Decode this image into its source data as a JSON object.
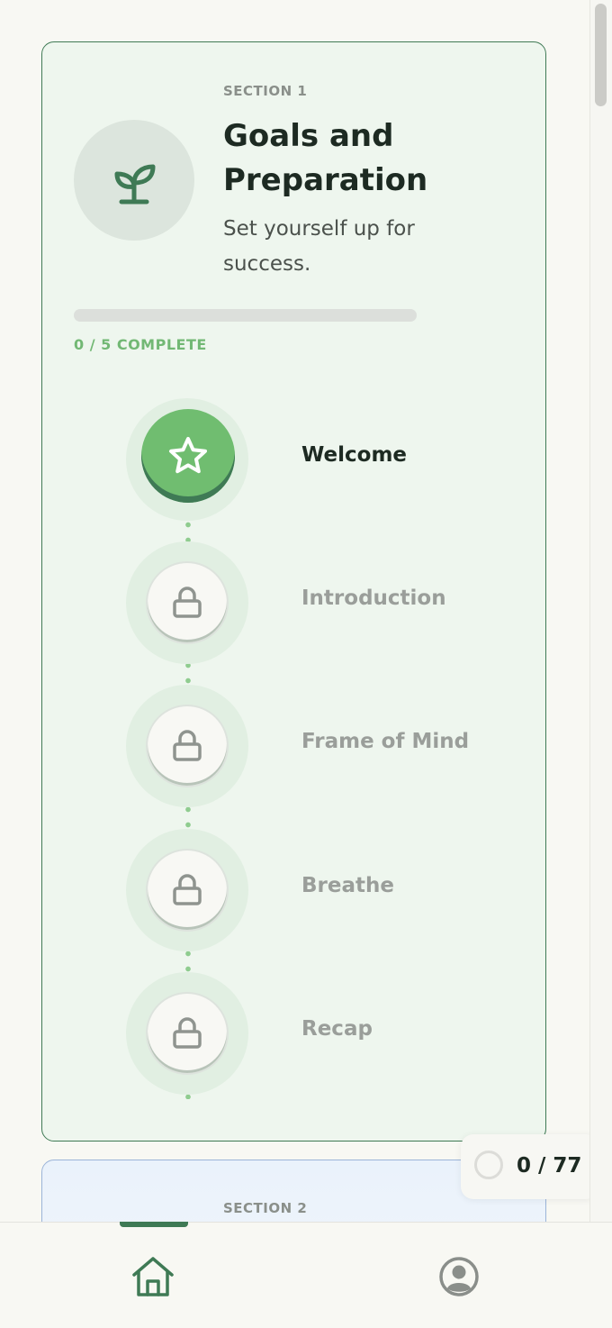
{
  "colors": {
    "accent_green": "#70bd70",
    "dark_green": "#3f7a55",
    "section2_border": "#9bb4d8"
  },
  "section1": {
    "eyebrow": "SECTION 1",
    "title": "Goals and Preparation",
    "subtitle": "Set yourself up for success.",
    "icon": "sprout-icon",
    "progress_fraction": 0,
    "progress_label": "0 / 5 COMPLETE",
    "lessons": [
      {
        "label": "Welcome",
        "state": "active",
        "icon": "star-icon"
      },
      {
        "label": "Introduction",
        "state": "locked",
        "icon": "lock-icon"
      },
      {
        "label": "Frame of Mind",
        "state": "locked",
        "icon": "lock-icon"
      },
      {
        "label": "Breathe",
        "state": "locked",
        "icon": "lock-icon"
      },
      {
        "label": "Recap",
        "state": "locked",
        "icon": "lock-icon"
      }
    ]
  },
  "section2": {
    "eyebrow": "SECTION 2"
  },
  "counter": {
    "text": "0 / 77",
    "icon": "progress-ring-icon"
  },
  "bottom_nav": {
    "items": [
      {
        "icon": "home-icon",
        "active": true
      },
      {
        "icon": "profile-icon",
        "active": false
      }
    ]
  }
}
